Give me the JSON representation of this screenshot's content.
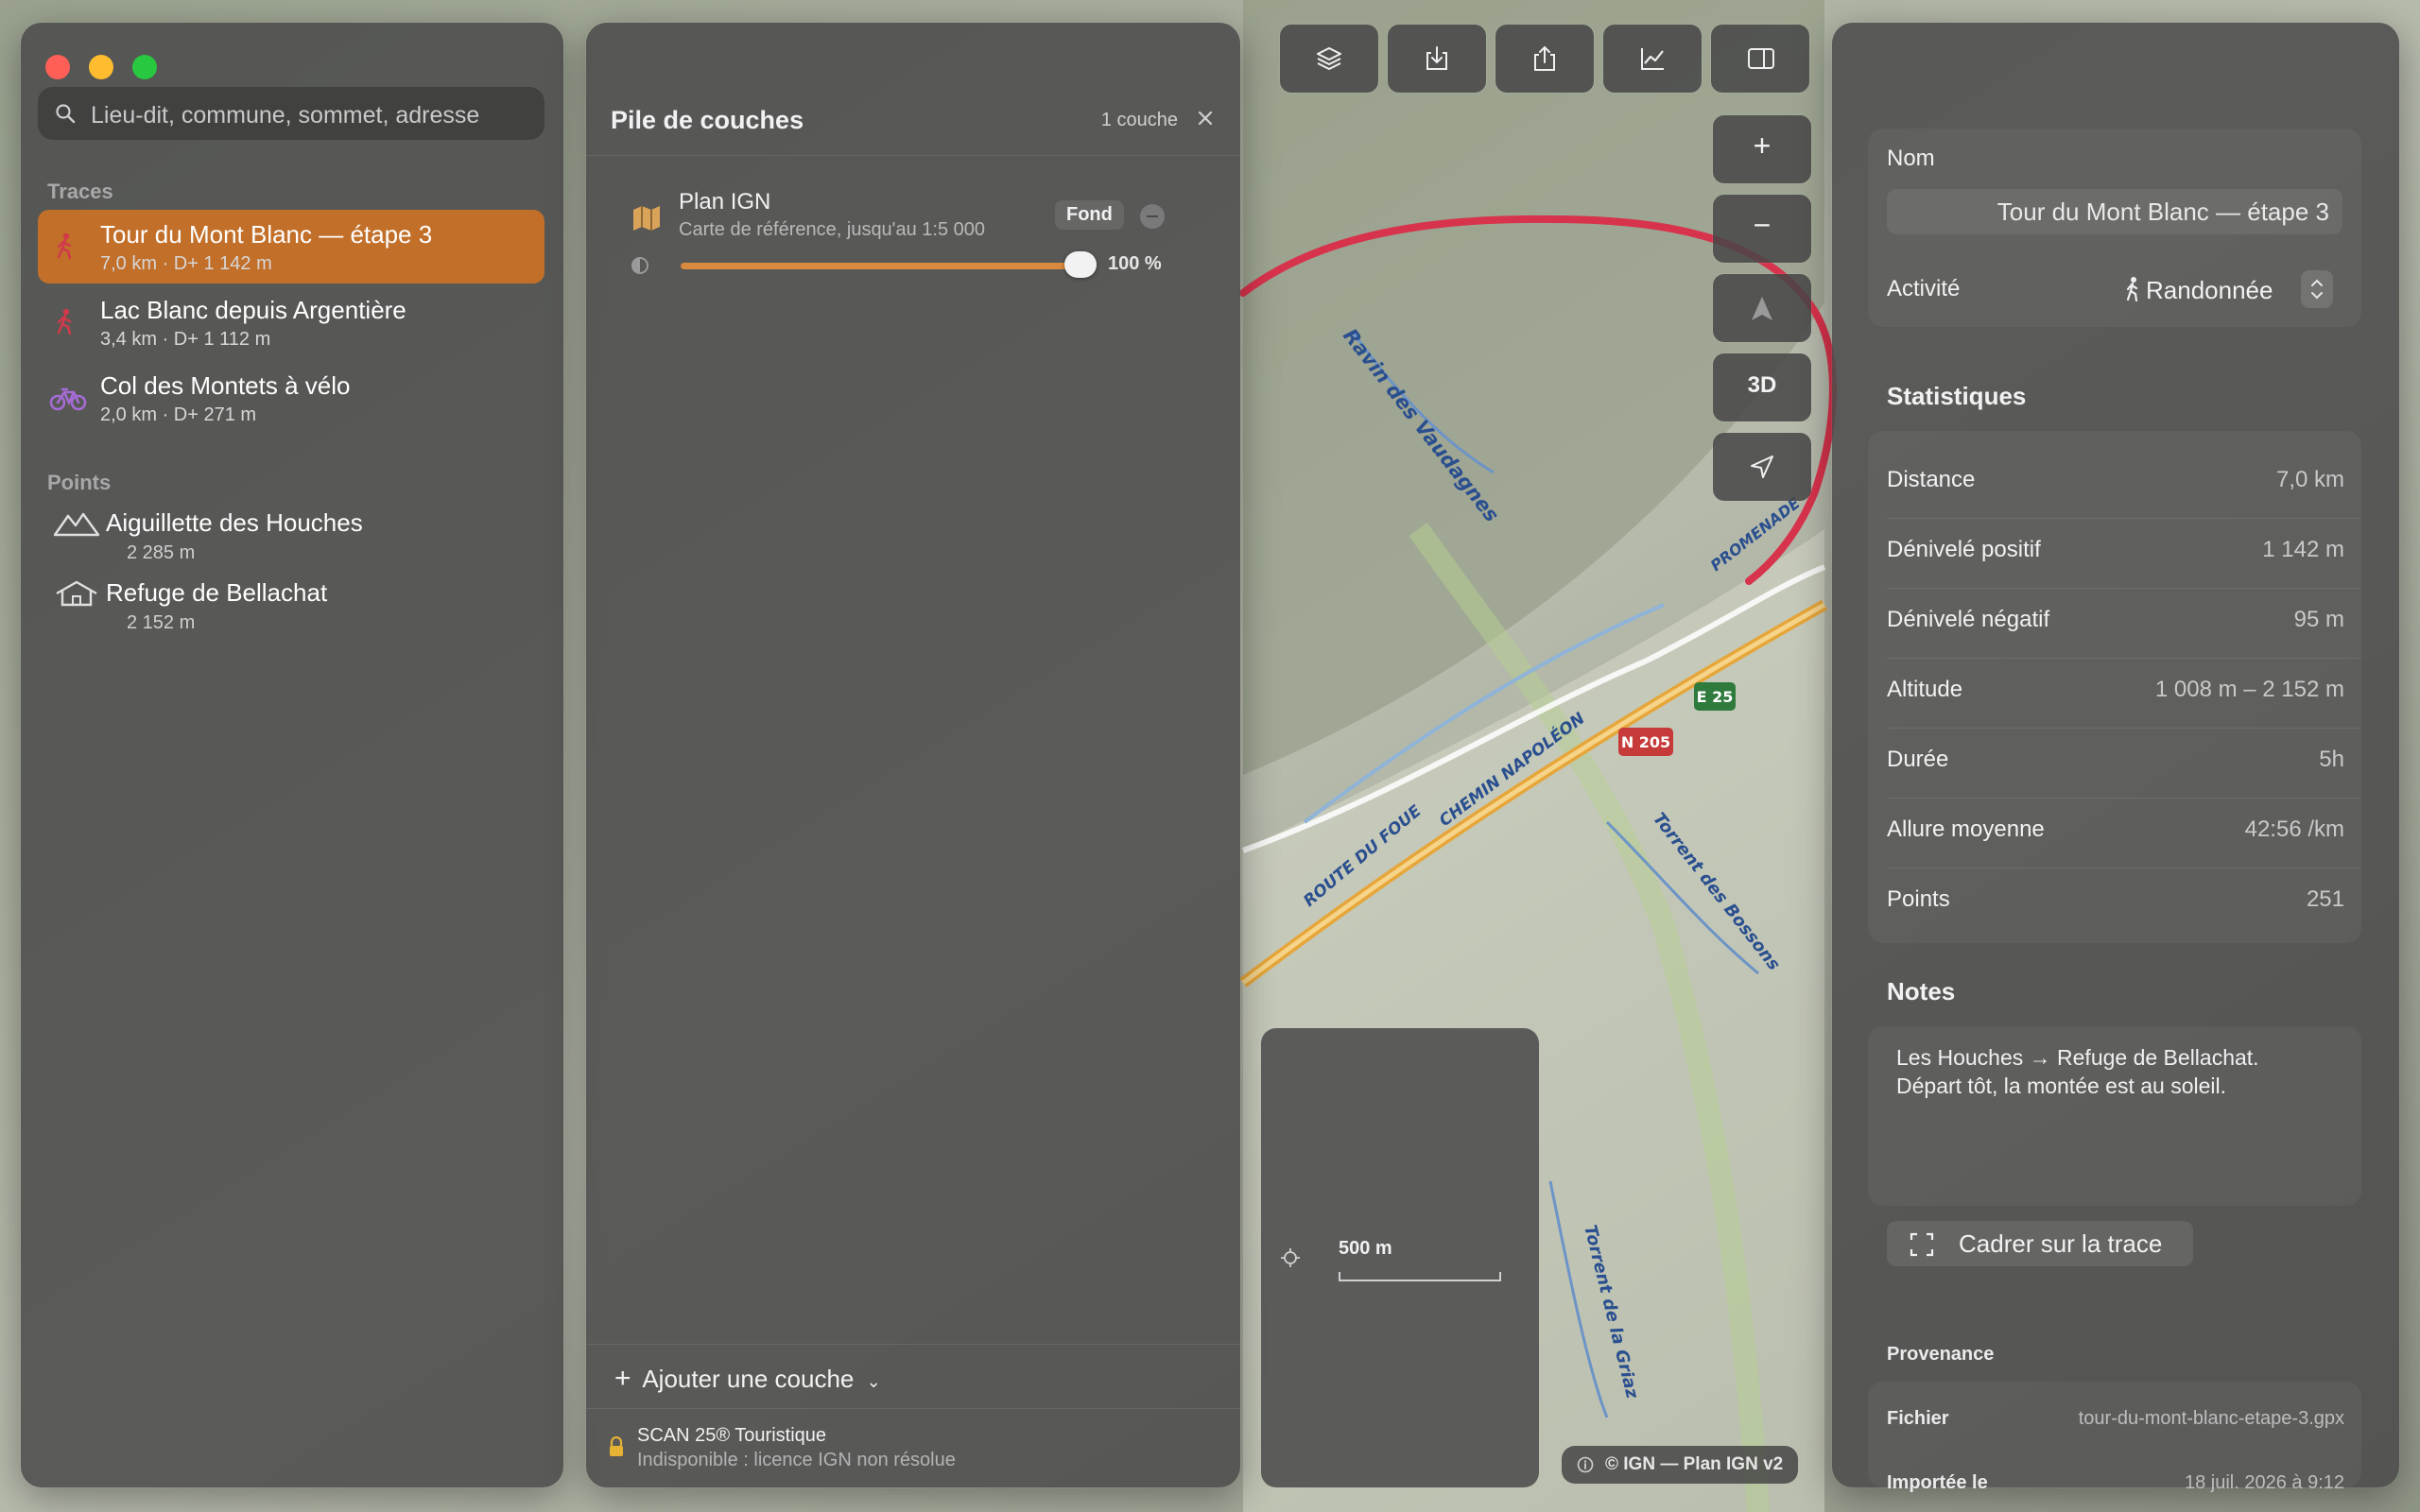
{
  "window": {
    "traffic_lights": [
      "#ff5f57",
      "#febc2e",
      "#28c840"
    ]
  },
  "sidebar": {
    "search_placeholder": "Lieu-dit, commune, sommet, adresse",
    "traces_heading": "Traces",
    "traces": [
      {
        "name": "Tour du Mont Blanc — étape 3",
        "meta": "7,0 km  ·  D+ 1 142 m",
        "activity_icon": "hiker-icon",
        "color": "#d03a4a",
        "selected": true
      },
      {
        "name": "Lac Blanc depuis Argentière",
        "meta": "3,4 km  ·  D+ 1 112 m",
        "activity_icon": "hiker-icon",
        "color": "#d03a4a",
        "selected": false
      },
      {
        "name": "Col des Montets à vélo",
        "meta": "2,0 km  ·  D+ 271 m",
        "activity_icon": "bike-icon",
        "color": "#a56bd4",
        "selected": false
      }
    ],
    "points_heading": "Points",
    "points": [
      {
        "name": "Aiguillette des Houches",
        "altitude": "2 285 m",
        "icon": "summit-icon"
      },
      {
        "name": "Refuge de Bellachat",
        "altitude": "2 152 m",
        "icon": "refuge-icon"
      }
    ]
  },
  "layers_panel": {
    "title": "Pile de couches",
    "count": "1 couche",
    "layer": {
      "name": "Plan IGN",
      "subtitle": "Carte de référence, jusqu'au 1:5 000",
      "badge": "Fond",
      "opacity_label": "100 %",
      "opacity": 1.0
    },
    "add_layer": "Ajouter une couche",
    "unavailable": {
      "name": "SCAN 25® Touristique",
      "reason": "Indisponible : licence IGN non résolue"
    }
  },
  "toolbar": {
    "buttons": [
      "layers-icon",
      "import-icon",
      "share-icon",
      "elevation-chart-icon",
      "inspector-toggle-icon"
    ]
  },
  "map_controls": {
    "zoom_in": "+",
    "zoom_out": "−",
    "three_d": "3D"
  },
  "map": {
    "labels": {
      "ravin": "Ravin des Vaudagnes",
      "promenade": "PROMENADE",
      "chemin": "CHEMIN NAPOLÉON",
      "route": "ROUTE DU FOUE",
      "torrent1": "Torrent des Bossons",
      "torrent2": "Torrent de la Griaz",
      "e25": "E 25",
      "n205": "N 205"
    },
    "scale_label": "500 m",
    "attribution": "© IGN — Plan IGN v2",
    "track_color": "#d8334c"
  },
  "inspector": {
    "name_label": "Nom",
    "name_value": "Tour du Mont Blanc — étape 3",
    "activity_label": "Activité",
    "activity_value": "Randonnée",
    "stats_heading": "Statistiques",
    "stats": [
      {
        "label": "Distance",
        "value": "7,0 km"
      },
      {
        "label": "Dénivelé positif",
        "value": "1 142 m"
      },
      {
        "label": "Dénivelé négatif",
        "value": "95 m"
      },
      {
        "label": "Altitude",
        "value": "1 008 m – 2 152 m"
      },
      {
        "label": "Durée",
        "value": "5h"
      },
      {
        "label": "Allure moyenne",
        "value": "42:56 /km"
      },
      {
        "label": "Points",
        "value": "251"
      }
    ],
    "notes_heading": "Notes",
    "notes": "Les Houches → Refuge de Bellachat.\nDépart tôt, la montée est au soleil.",
    "frame_button": "Cadrer sur la trace",
    "provenance_heading": "Provenance",
    "file_label": "Fichier",
    "file_value": "tour-du-mont-blanc-etape-3.gpx",
    "imported_label": "Importée le",
    "imported_value": "18 juil. 2026 à 9:12"
  }
}
